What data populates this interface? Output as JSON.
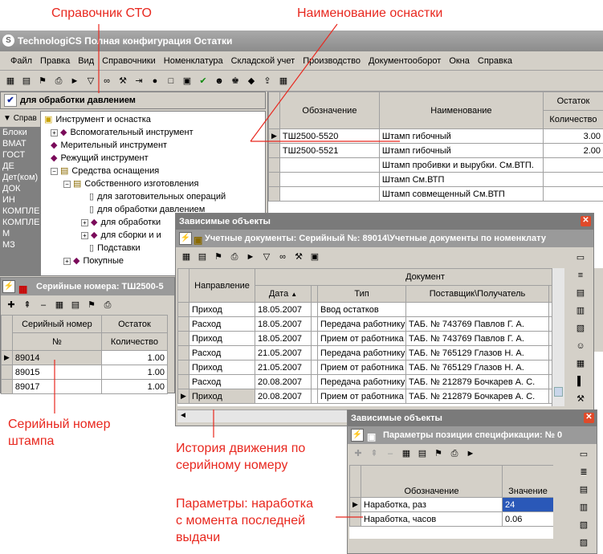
{
  "annotations": {
    "sto": "Справочник СТО",
    "tool_name": "Наименование оснастки",
    "serial": "Серийный номер\nштампа",
    "history": "История движения по\nсерийному номеру",
    "params": "Параметры: наработка\nс момента последней\nвыдачи"
  },
  "app": {
    "title": "TechnologiCS Полная конфигурация Остатки"
  },
  "menu": [
    "Файл",
    "Правка",
    "Вид",
    "Справочники",
    "Номенклатура",
    "Складской учет",
    "Производство",
    "Документооборот",
    "Окна",
    "Справка"
  ],
  "tree_header": "для обработки давлением",
  "left_list_header": "Справ",
  "left_list": [
    "Блоки",
    "ВМАТ",
    "ГОСТ",
    "ДЕ",
    "Дет(ком)",
    "ДОК",
    "ИН",
    "КОМПЛЕ",
    "КОМПЛЕ",
    "М",
    "МЗ"
  ],
  "tree": [
    "Инструмент и оснастка",
    "Вспомогательный инструмент",
    "Мерительный инструмент",
    "Режущий инструмент",
    "Средства оснащения",
    "Собственного изготовления",
    "для заготовительных операций",
    "для обработки давлением",
    "для обработки",
    "для сборки и и",
    "Подставки",
    "Покупные"
  ],
  "main_grid": {
    "headers": {
      "code": "Обозначение",
      "name": "Наименование",
      "stock": "Остаток",
      "qty": "Количество"
    },
    "rows": [
      {
        "code": "ТШ2500-5520",
        "name": "Штамп гибочный",
        "qty": "3.00"
      },
      {
        "code": "ТШ2500-5521",
        "name": "Штамп гибочный",
        "qty": "2.00"
      },
      {
        "code": "",
        "name": "Штамп пробивки и вырубки. См.ВТП.",
        "qty": ""
      },
      {
        "code": "",
        "name": "Штамп См.ВТП",
        "qty": ""
      },
      {
        "code": "",
        "name": "Штамп совмещенный См.ВТП",
        "qty": ""
      }
    ]
  },
  "serial_panel": {
    "title": "Серийные номера: ТШ2500-5",
    "headers": {
      "serial": "Серийный номер",
      "no": "№",
      "stock": "Остаток",
      "qty": "Количество"
    },
    "rows": [
      {
        "serial": "89014",
        "qty": "1.00"
      },
      {
        "serial": "89015",
        "qty": "1.00"
      },
      {
        "serial": "89017",
        "qty": "1.00"
      }
    ]
  },
  "dep1": {
    "title": "Зависимые объекты",
    "subtitle": "Учетные документы: Серийный №: 89014\\Учетные документы по номенклату",
    "headers": {
      "dir": "Направление",
      "doc": "Документ",
      "date": "Дата",
      "type": "Тип",
      "party": "Поставщик\\Получатель"
    },
    "rows": [
      {
        "dir": "Приход",
        "date": "18.05.2007",
        "type": "Ввод остатков",
        "party": ""
      },
      {
        "dir": "Расход",
        "date": "18.05.2007",
        "type": "Передача работнику",
        "party": "ТАБ. № 743769  Павлов Г. А."
      },
      {
        "dir": "Приход",
        "date": "18.05.2007",
        "type": "Прием от работника",
        "party": "ТАБ. № 743769  Павлов Г. А."
      },
      {
        "dir": "Расход",
        "date": "21.05.2007",
        "type": "Передача работнику",
        "party": "ТАБ. № 765129  Глазов Н. А."
      },
      {
        "dir": "Приход",
        "date": "21.05.2007",
        "type": "Прием от работника",
        "party": "ТАБ. № 765129  Глазов Н. А."
      },
      {
        "dir": "Расход",
        "date": "20.08.2007",
        "type": "Передача работнику",
        "party": "ТАБ. № 212879  Бочкарев А. С."
      },
      {
        "dir": "Приход",
        "date": "20.08.2007",
        "type": "Прием от работника",
        "party": "ТАБ. № 212879  Бочкарев А. С."
      }
    ]
  },
  "dep2": {
    "title": "Зависимые объекты",
    "subtitle": "Параметры позиции спецификации: № 0",
    "headers": {
      "code": "Обозначение",
      "value": "Значение"
    },
    "rows": [
      {
        "code": "Наработка, раз",
        "value": "24"
      },
      {
        "code": "Наработка, часов",
        "value": "0.06"
      }
    ]
  }
}
